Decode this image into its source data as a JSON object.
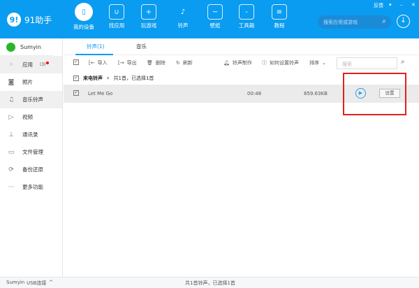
{
  "app": {
    "logo_mark": "9!",
    "name": "91助手"
  },
  "nav": [
    {
      "label": "我的设备",
      "icon": "phone-icon"
    },
    {
      "label": "找应用",
      "icon": "bag-icon"
    },
    {
      "label": "玩游戏",
      "icon": "gamepad-icon"
    },
    {
      "label": "铃声",
      "icon": "music-icon"
    },
    {
      "label": "壁纸",
      "icon": "image-icon"
    },
    {
      "label": "工具箱",
      "icon": "toolbox-icon"
    },
    {
      "label": "教程",
      "icon": "clipboard-icon"
    }
  ],
  "header": {
    "search_placeholder": "搜索应用或游戏",
    "feedback": "反馈",
    "menu": "▾",
    "minimize": "–",
    "close": "✕"
  },
  "sidebar": {
    "device": "Sumyin",
    "items": [
      {
        "label": "应用",
        "badge": "(3)"
      },
      {
        "label": "照片"
      },
      {
        "label": "音乐铃声"
      },
      {
        "label": "视频"
      },
      {
        "label": "通讯录"
      },
      {
        "label": "文件管理"
      },
      {
        "label": "备份还原"
      },
      {
        "label": "更多功能"
      }
    ]
  },
  "tabs": [
    "铃声(1)",
    "音乐"
  ],
  "toolbar": {
    "import": "导入",
    "export": "导出",
    "delete": "删除",
    "refresh": "刷新",
    "make": "铃声制作",
    "howto": "如何设置铃声",
    "sort": "排序",
    "search_placeholder": "搜索"
  },
  "group": {
    "name": "来电铃声",
    "summary": "共1首，已选择1首"
  },
  "rows": [
    {
      "title": "Let Me Go",
      "duration": "00:48",
      "size": "859.63KB",
      "action": "设置"
    }
  ],
  "status": {
    "device": "Sumyin",
    "connection": "USB连接",
    "summary": "共1首铃声，已选择1首"
  }
}
